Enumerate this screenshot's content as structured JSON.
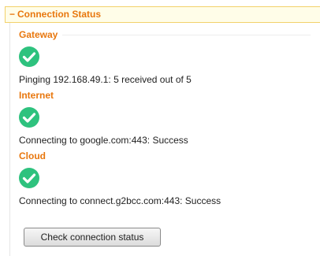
{
  "panel": {
    "toggle_symbol": "−",
    "title": "Connection Status"
  },
  "sections": [
    {
      "title": "Gateway",
      "status_icon": "check-circle-icon",
      "status_color": "#2ec27e",
      "message": "Pinging 192.168.49.1: 5 received out of 5"
    },
    {
      "title": "Internet",
      "status_icon": "check-circle-icon",
      "status_color": "#2ec27e",
      "message": "Connecting to google.com:443: Success"
    },
    {
      "title": "Cloud",
      "status_icon": "check-circle-icon",
      "status_color": "#2ec27e",
      "message": "Connecting to connect.g2bcc.com:443: Success"
    }
  ],
  "check_button": {
    "label": "Check connection status"
  },
  "colors": {
    "accent": "#e8770e",
    "header_bg": "#fffde8",
    "header_border": "#f2d16b"
  }
}
